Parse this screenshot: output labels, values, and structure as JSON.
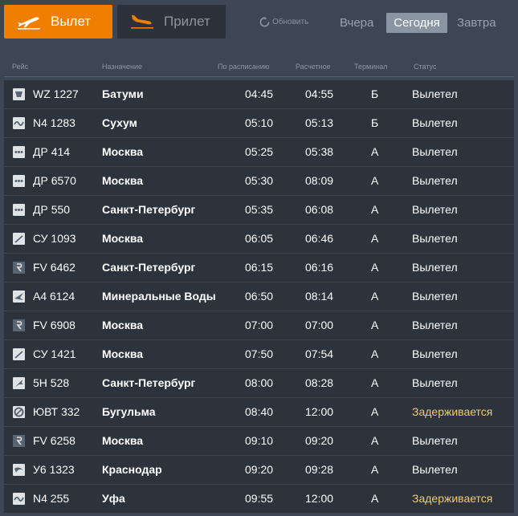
{
  "tabs": {
    "departures": "Вылет",
    "arrivals": "Прилет"
  },
  "refresh_label": "Обновить",
  "days": {
    "yesterday": "Вчера",
    "today": "Сегодня",
    "tomorrow": "Завтра"
  },
  "colors": {
    "accent": "#f07f00",
    "delayed": "#f2c96b",
    "row_bg": "#2c333c",
    "page_bg": "#3d4653"
  },
  "columns": {
    "flight": "Рейс",
    "destination": "Назначение",
    "scheduled": "По расписанию",
    "estimated": "Расчетное",
    "terminal": "Терминал",
    "status": "Статус"
  },
  "flights": [
    {
      "logo": "wizz-logo-icon",
      "flight": "WZ 1227",
      "destination": "Батуми",
      "scheduled": "04:45",
      "estimated": "04:55",
      "terminal": "Б",
      "status": "Вылетел",
      "delayed": false
    },
    {
      "logo": "wave-logo-icon",
      "flight": "N4 1283",
      "destination": "Сухум",
      "scheduled": "05:10",
      "estimated": "05:13",
      "terminal": "Б",
      "status": "Вылетел",
      "delayed": false
    },
    {
      "logo": "dots-logo-icon",
      "flight": "ДР 414",
      "destination": "Москва",
      "scheduled": "05:25",
      "estimated": "05:38",
      "terminal": "А",
      "status": "Вылетел",
      "delayed": false
    },
    {
      "logo": "dots-logo-icon",
      "flight": "ДР 6570",
      "destination": "Москва",
      "scheduled": "05:30",
      "estimated": "08:09",
      "terminal": "А",
      "status": "Вылетел",
      "delayed": false
    },
    {
      "logo": "dots-logo-icon",
      "flight": "ДР 550",
      "destination": "Санкт-Петербург",
      "scheduled": "05:35",
      "estimated": "06:08",
      "terminal": "А",
      "status": "Вылетел",
      "delayed": false
    },
    {
      "logo": "slash-logo-icon",
      "flight": "СУ 1093",
      "destination": "Москва",
      "scheduled": "06:05",
      "estimated": "06:46",
      "terminal": "А",
      "status": "Вылетел",
      "delayed": false
    },
    {
      "logo": "r-logo-icon",
      "flight": "FV 6462",
      "destination": "Санкт-Петербург",
      "scheduled": "06:15",
      "estimated": "06:16",
      "terminal": "А",
      "status": "Вылетел",
      "delayed": false
    },
    {
      "logo": "wing-logo-icon",
      "flight": "А4 6124",
      "destination": "Минеральные Воды",
      "scheduled": "06:50",
      "estimated": "08:14",
      "terminal": "А",
      "status": "Вылетел",
      "delayed": false
    },
    {
      "logo": "r-logo-icon",
      "flight": "FV 6908",
      "destination": "Москва",
      "scheduled": "07:00",
      "estimated": "07:00",
      "terminal": "А",
      "status": "Вылетел",
      "delayed": false
    },
    {
      "logo": "slash-logo-icon",
      "flight": "СУ 1421",
      "destination": "Москва",
      "scheduled": "07:50",
      "estimated": "07:54",
      "terminal": "А",
      "status": "Вылетел",
      "delayed": false
    },
    {
      "logo": "plane-logo-icon",
      "flight": "5Н 528",
      "destination": "Санкт-Петербург",
      "scheduled": "08:00",
      "estimated": "08:28",
      "terminal": "А",
      "status": "Вылетел",
      "delayed": false
    },
    {
      "logo": "ring-logo-icon",
      "flight": "ЮВТ 332",
      "destination": "Бугульма",
      "scheduled": "08:40",
      "estimated": "12:00",
      "terminal": "А",
      "status": "Задерживается",
      "delayed": true
    },
    {
      "logo": "r-logo-icon",
      "flight": "FV 6258",
      "destination": "Москва",
      "scheduled": "09:10",
      "estimated": "09:20",
      "terminal": "А",
      "status": "Вылетел",
      "delayed": false
    },
    {
      "logo": "swoosh-logo-icon",
      "flight": "У6 1323",
      "destination": "Краснодар",
      "scheduled": "09:20",
      "estimated": "09:28",
      "terminal": "А",
      "status": "Вылетел",
      "delayed": false
    },
    {
      "logo": "wave-logo-icon",
      "flight": "N4 255",
      "destination": "Уфа",
      "scheduled": "09:55",
      "estimated": "12:00",
      "terminal": "А",
      "status": "Задерживается",
      "delayed": true
    }
  ]
}
